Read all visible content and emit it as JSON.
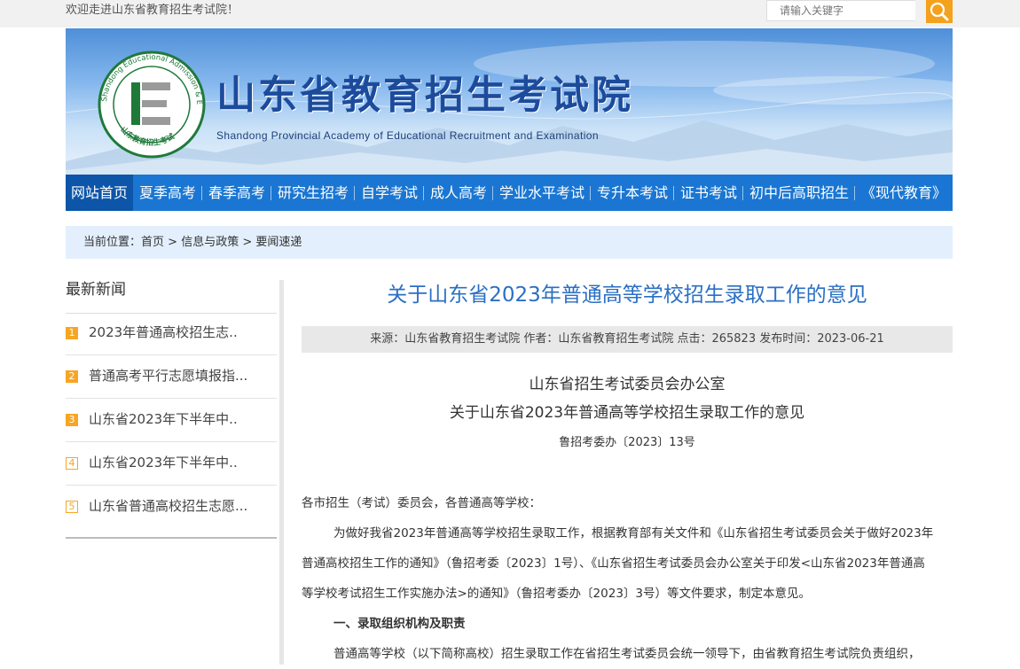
{
  "topbar": {
    "welcome": "欢迎走进山东省教育招生考试院！",
    "search_placeholder": "请输入关键字"
  },
  "banner": {
    "title": "山东省教育招生考试院",
    "subtitle": "Shandong Provincial Academy of Educational Recruitment and Examination",
    "logo_ring_text": "Shandong Educational Admission & Examinations",
    "logo_bottom_text": "山东教育招生考试",
    "logo_letter": "E"
  },
  "nav": {
    "items": [
      "网站首页",
      "夏季高考",
      "春季高考",
      "研究生招考",
      "自学考试",
      "成人高考",
      "学业水平考试",
      "专升本考试",
      "证书考试",
      "初中后高职招生",
      "《现代教育》"
    ],
    "active_index": 0
  },
  "breadcrumb": {
    "prefix": "当前位置：",
    "items": [
      "首页",
      "信息与政策",
      "要闻速递"
    ],
    "separator": ">"
  },
  "sidebar": {
    "title": "最新新闻",
    "items": [
      {
        "num": "1",
        "text": "2023年普通高校招生志.."
      },
      {
        "num": "2",
        "text": "普通高考平行志愿填报指..."
      },
      {
        "num": "3",
        "text": "山东省2023年下半年中.."
      },
      {
        "num": "4",
        "text": "山东省2023年下半年中.."
      },
      {
        "num": "5",
        "text": "山东省普通高校招生志愿..."
      }
    ]
  },
  "article": {
    "title": "关于山东省2023年普通高等学校招生录取工作的意见",
    "meta": "来源：山东省教育招生考试院 作者：山东省教育招生考试院 点击：265823 发布时间：2023-06-21",
    "doc_org": "山东省招生考试委员会办公室",
    "doc_title": "关于山东省2023年普通高等学校招生录取工作的意见",
    "doc_no": "鲁招考委办〔2023〕13号",
    "salutation": "各市招生（考试）委员会，各普通高等学校：",
    "para1_line1": "为做好我省2023年普通高等学校招生录取工作，根据教育部有关文件和《山东省招生考试委员会关于做好2023年",
    "para1_line2": "普通高校招生工作的通知》（鲁招考委〔2023〕1号）、《山东省招生考试委员会办公室关于印发<山东省2023年普通高",
    "para1_line3": "等学校考试招生工作实施办法>的通知》（鲁招考委办〔2023〕3号）等文件要求，制定本意见。",
    "section1": "一、录取组织机构及职责",
    "para2_line1": "普通高等学校（以下简称高校）招生录取工作在省招生考试委员会统一领导下，由省教育招生考试院负责组织，"
  },
  "colors": {
    "nav_bg": "#1a76d2",
    "nav_active": "#0c55a8",
    "title_blue": "#2a6fc4",
    "badge_orange": "#f6a623",
    "search_orange": "#f4a11c"
  }
}
